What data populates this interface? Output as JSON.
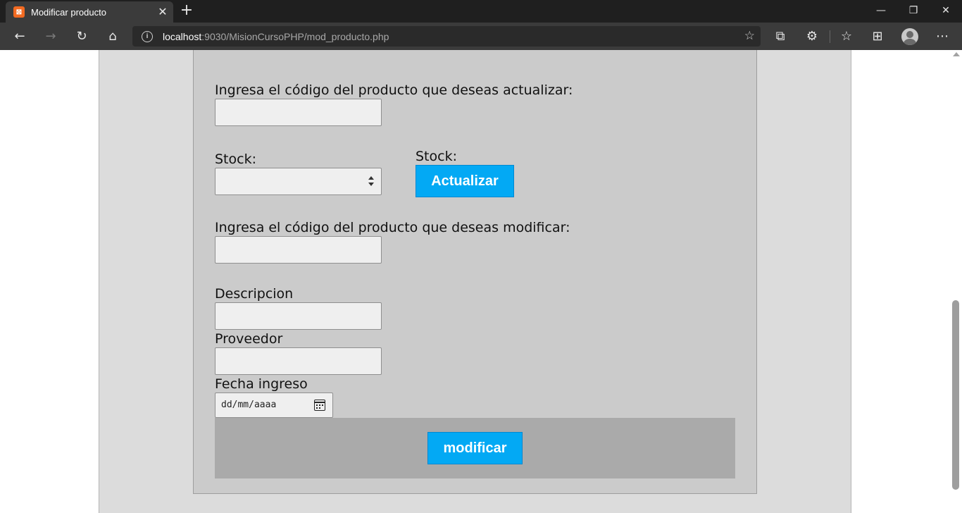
{
  "browser": {
    "tab_title": "Modificar producto",
    "favicon_text": "⊠",
    "close_tab_glyph": "✕",
    "new_tab_glyph": "+",
    "window_controls": {
      "minimize": "—",
      "restore": "❐",
      "close": "✕"
    },
    "url_host": "localhost",
    "url_rest": ":9030/MisionCursoPHP/mod_producto.php",
    "info_glyph": "i",
    "nav_glyphs": {
      "back": "←",
      "forward": "→",
      "reload": "↻",
      "home": "⌂"
    },
    "right_glyphs": {
      "favorite": "☆",
      "collections": "⧉",
      "extensions": "⚙",
      "favorites_list": "☆",
      "tabs": "⊞",
      "more": "⋯"
    }
  },
  "form": {
    "update_code_label": "Ingresa el código del producto que deseas actualizar:",
    "update_code_value": "",
    "stock_label_left": "Stock:",
    "stock_value": "",
    "stock_label_right": "Stock:",
    "update_button": "Actualizar",
    "modify_code_label": "Ingresa el código del producto que deseas modificar:",
    "modify_code_value": "",
    "description_label": "Descripcion",
    "description_value": "",
    "provider_label": "Proveedor",
    "provider_value": "",
    "date_label": "Fecha ingreso",
    "date_placeholder": "dd/mm/aaaa",
    "modify_button": "modificar"
  },
  "colors": {
    "accent_button": "#03a9f4",
    "page_background": "#dcdcdc",
    "form_panel": "#cbcbcb",
    "footer_bar": "#aaaaaa"
  }
}
